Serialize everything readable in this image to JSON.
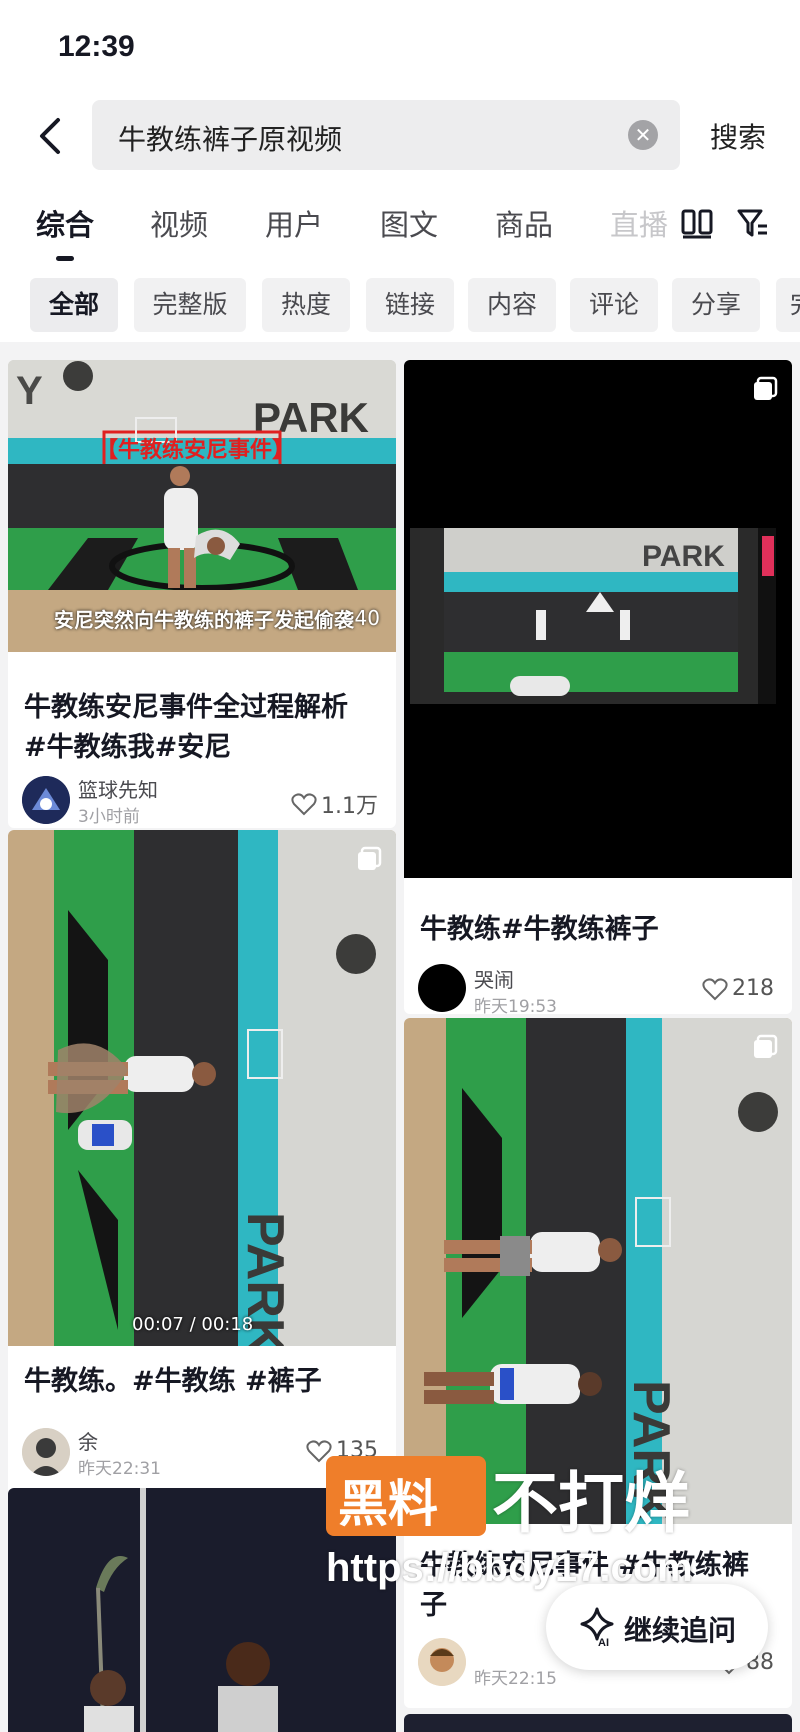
{
  "status_bar": {
    "time": "12:39"
  },
  "search": {
    "query": "牛教练裤子原视频",
    "button_label": "搜索"
  },
  "tabs": [
    {
      "label": "综合"
    },
    {
      "label": "视频"
    },
    {
      "label": "用户"
    },
    {
      "label": "图文"
    },
    {
      "label": "商品"
    },
    {
      "label": "直播"
    }
  ],
  "filters": [
    "全部",
    "完整版",
    "热度",
    "链接",
    "内容",
    "评论",
    "分享",
    "完"
  ],
  "feed": [
    {
      "overlay_title": "【牛教练安尼事件】",
      "caption": "安尼突然向牛教练的裤子发起偷袭",
      "caption_num": "40",
      "title": "牛教练安尼事件全过程解析 #牛教练我#安尼",
      "author": "篮球先知",
      "time": "3小时前",
      "likes": "1.1万"
    },
    {
      "title": "牛教练#牛教练裤子",
      "author": "哭闹",
      "time": "昨天19:53",
      "likes": "218"
    },
    {
      "duration": "00:07 / 00:18",
      "title": "牛教练。#牛教练 #裤子",
      "author": "余",
      "time": "昨天22:31",
      "likes": "135"
    },
    {
      "title": "牛教练安尼事件 #牛教练裤子",
      "author": "",
      "time": "昨天22:15",
      "likes": "88"
    }
  ],
  "watermark": {
    "box_text": "黑料",
    "text": "不打烊",
    "url": "https://bbdy17.com"
  },
  "continue_ask": {
    "label": "继续追问",
    "ai_tag": "AI"
  },
  "colors": {
    "accent": "#161823",
    "court_green": "#2f9e4a",
    "banner_teal": "#2fb7c2",
    "watermark_orange": "#ef7e2a"
  }
}
